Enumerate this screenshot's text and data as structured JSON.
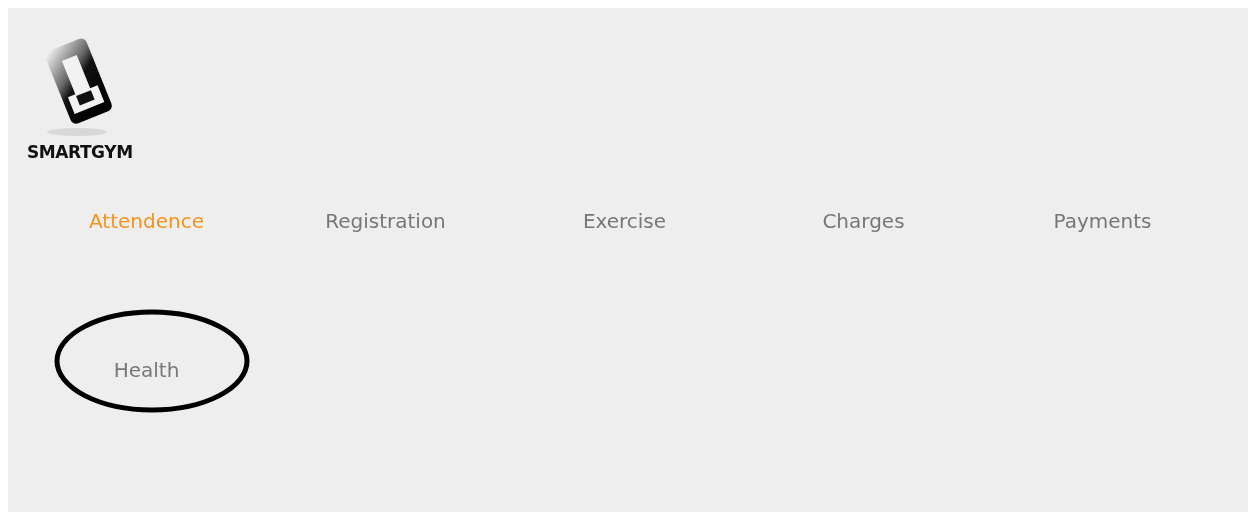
{
  "logo": {
    "text": "SMARTGYM"
  },
  "nav": [
    {
      "label": "Attendence",
      "selected": true,
      "circled": false
    },
    {
      "label": "Registration",
      "selected": false,
      "circled": false
    },
    {
      "label": "Exercise",
      "selected": false,
      "circled": false
    },
    {
      "label": "Charges",
      "selected": false,
      "circled": false
    },
    {
      "label": "Payments",
      "selected": false,
      "circled": false
    },
    {
      "label": "Health",
      "selected": false,
      "circled": true
    }
  ]
}
